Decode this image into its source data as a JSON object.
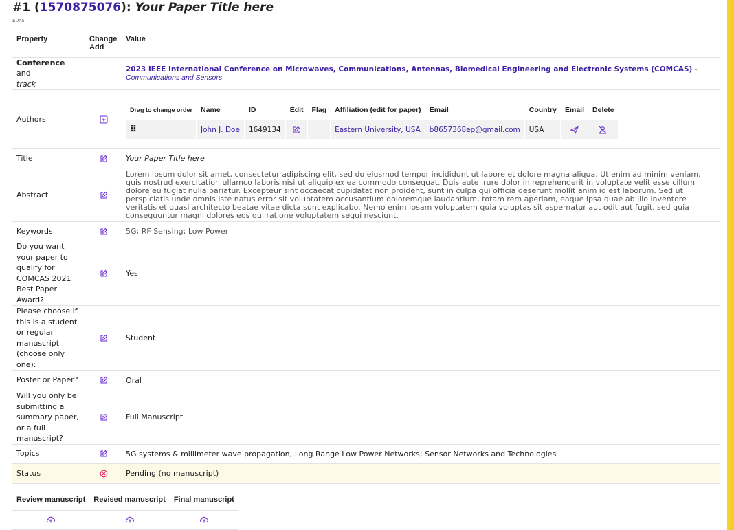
{
  "header": {
    "prefix": "#1 (",
    "paper_id": "1570875076",
    "suffix": "): ",
    "paper_title": "Your Paper Title here",
    "logo_text": "EDAS"
  },
  "table_headers": {
    "property": "Property",
    "change_add": "Change Add",
    "value": "Value"
  },
  "conference": {
    "label_bold": "Conference",
    "label_and": " and",
    "label_track": "track",
    "name": "2023 IEEE International Conference on Microwaves, Communications, Antennas, Biomedical Engineering and Electronic Systems (COMCAS)",
    "separator": " - ",
    "track": "Communications and Sensors"
  },
  "authors": {
    "label": "Authors",
    "columns": [
      "Drag to change order",
      "Name",
      "ID",
      "Edit",
      "Flag",
      "Affiliation (edit for paper)",
      "Email",
      "Country",
      "Email",
      "Delete"
    ],
    "rows": [
      {
        "drag": "⠿",
        "name": "John J. Doe",
        "id": "1649134",
        "affiliation": "Eastern University, USA",
        "email": "b8657368ep@gmail.com",
        "country": "USA"
      }
    ]
  },
  "rows": {
    "title": {
      "label": "Title",
      "value": "Your Paper Title here"
    },
    "abstract": {
      "label": "Abstract",
      "value": "Lorem ipsum dolor sit amet, consectetur adipiscing elit, sed do eiusmod tempor incididunt ut labore et dolore magna aliqua. Ut enim ad minim veniam, quis nostrud exercitation ullamco laboris nisi ut aliquip ex ea commodo consequat. Duis aute irure dolor in reprehenderit in voluptate velit esse cillum dolore eu fugiat nulla pariatur. Excepteur sint occaecat cupidatat non proident, sunt in culpa qui officia deserunt mollit anim id est laborum. Sed ut perspiciatis unde omnis iste natus error sit voluptatem accusantium doloremque laudantium, totam rem aperiam, eaque ipsa quae ab illo inventore veritatis et quasi architecto beatae vitae dicta sunt explicabo. Nemo enim ipsam voluptatem quia voluptas sit aspernatur aut odit aut fugit, sed quia consequuntur magni dolores eos qui ratione voluptatem sequi nesciunt."
    },
    "keywords": {
      "label": "Keywords",
      "value": "5G; RF Sensing; Low Power"
    },
    "best_paper": {
      "label": "Do you want your paper to qualify for COMCAS 2021 Best Paper Award?",
      "value": "Yes"
    },
    "student": {
      "label": "Please choose if this is a student or regular manuscript (choose only one):",
      "value": "Student"
    },
    "poster": {
      "label": "Poster or Paper?",
      "value": "Oral"
    },
    "summary": {
      "label": "Will you only be submitting a summary paper, or a full manuscript?",
      "value": "Full Manuscript"
    },
    "topics": {
      "label": "Topics",
      "value": "5G systems & millimeter wave propagation; Long Range Low Power Networks; Sensor Networks and Technologies"
    },
    "status": {
      "label": "Status",
      "value": "Pending (no manuscript)"
    }
  },
  "manuscripts": {
    "review": "Review manuscript",
    "revised": "Revised manuscript",
    "final": "Final manuscript"
  },
  "icons": {
    "edit": "edit-icon",
    "add": "add-icon",
    "status": "circle-x-icon",
    "upload": "upload-cloud-icon",
    "send": "send-icon",
    "delete_user": "delete-user-icon"
  },
  "colors": {
    "accent": "#3b1fa3",
    "icon": "#6a2fd0",
    "status_icon": "#e0245e",
    "status_bg": "#fdfae8",
    "right_border": "#f9c91c"
  }
}
